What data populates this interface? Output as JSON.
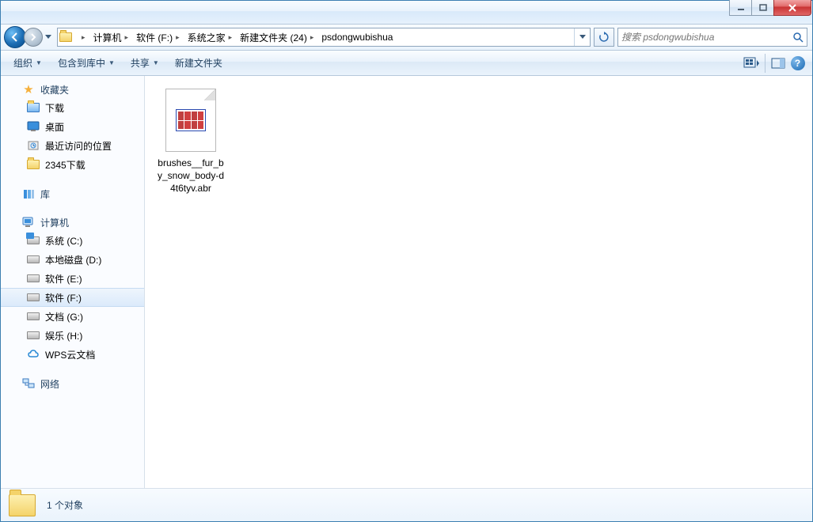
{
  "breadcrumb": [
    "计算机",
    "软件 (F:)",
    "系统之家",
    "新建文件夹 (24)",
    "psdongwubishua"
  ],
  "search": {
    "placeholder": "搜索 psdongwubishua"
  },
  "toolbar": {
    "organize": "组织",
    "include": "包含到库中",
    "share": "共享",
    "newfolder": "新建文件夹"
  },
  "sidebar": {
    "favorites": {
      "label": "收藏夹",
      "items": [
        "下载",
        "桌面",
        "最近访问的位置",
        "2345下载"
      ]
    },
    "libraries": {
      "label": "库"
    },
    "computer": {
      "label": "计算机",
      "items": [
        "系统 (C:)",
        "本地磁盘 (D:)",
        "软件 (E:)",
        "软件 (F:)",
        "文档 (G:)",
        "娱乐 (H:)",
        "WPS云文档"
      ],
      "selected": "软件 (F:)"
    },
    "network": {
      "label": "网络"
    }
  },
  "files": [
    {
      "name": "brushes__fur_by_snow_body-d4t6tyv.abr"
    }
  ],
  "status": {
    "text": "1 个对象"
  }
}
